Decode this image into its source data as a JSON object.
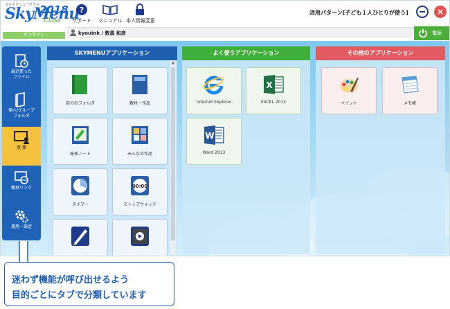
{
  "logo": {
    "sub": "スカイメニュークラス",
    "sky": "SkyMenu",
    "year": "2018",
    "class": "Class"
  },
  "online_status": "オンライン",
  "header_buttons": [
    {
      "label": "サポート",
      "icon": "help-icon"
    },
    {
      "label": "マニュアル",
      "icon": "book-icon"
    },
    {
      "label": "本人情報変更",
      "icon": "lock-icon"
    }
  ],
  "pattern_label": "活用パターン[子ども１人ひとりが使う]",
  "user": {
    "name": "kyouink / 教員 和彦"
  },
  "power": {
    "label": "電源"
  },
  "sidebar": [
    {
      "label": "最近使った\nファイル",
      "icon": "recent-files-icon"
    },
    {
      "label": "個人/グループ\nフォルダ",
      "icon": "folder-icon"
    },
    {
      "label": "授 業",
      "icon": "lesson-icon",
      "active": true
    },
    {
      "label": "教材リンク",
      "icon": "material-link-icon"
    },
    {
      "label": "運用・設定",
      "icon": "settings-icon"
    }
  ],
  "panels": {
    "skymenu": {
      "title": "SKYMENUアプリケーション",
      "apps": [
        "自分のフォルダ",
        "教材・作品",
        "発表ノート",
        "みんなの作品",
        "タイマー",
        "ストップウォッチ",
        "",
        ""
      ]
    },
    "favorite": {
      "title": "よく使うアプリケーション",
      "apps": [
        "Internet Explorer",
        "EXCEL 2013",
        "Word 2013"
      ]
    },
    "other": {
      "title": "その他のアプリケーション",
      "apps": [
        "ペイント",
        "メモ帳"
      ]
    }
  },
  "stopwatch_display": "00:00",
  "callout": {
    "line1": "迷わず機能が呼び出せるよう",
    "line2": "目的ごとにタブで分類しています"
  },
  "colors": {
    "accent_blue": "#1e5fb0",
    "accent_green": "#3fae3a",
    "accent_red": "#e05a60",
    "active_tab": "#f6c13c"
  }
}
